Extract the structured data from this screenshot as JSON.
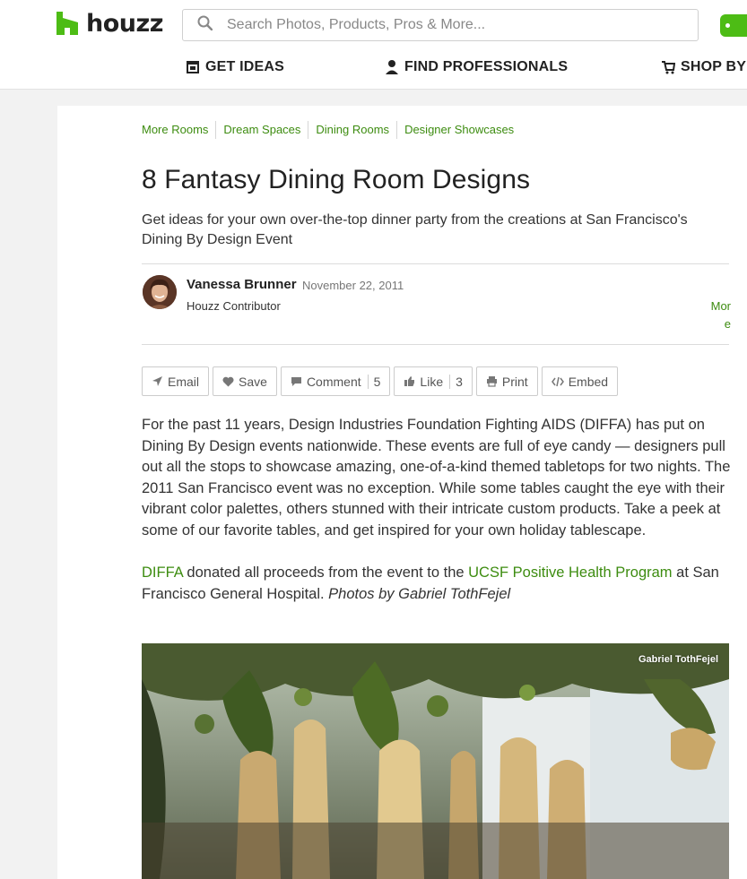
{
  "header": {
    "logo_text": "houzz",
    "search_placeholder": "Search Photos, Products, Pros & More...",
    "brand_color": "#4dbc15"
  },
  "nav": [
    {
      "label": "GET IDEAS",
      "icon": "gallery-icon"
    },
    {
      "label": "FIND PROFESSIONALS",
      "icon": "professional-icon"
    },
    {
      "label": "SHOP BY D",
      "icon": "shopping-cart-icon"
    }
  ],
  "breadcrumbs": [
    "More Rooms",
    "Dream Spaces",
    "Dining Rooms",
    "Designer Showcases"
  ],
  "article": {
    "title": "8 Fantasy Dining Room Designs",
    "subtitle": "Get ideas for your own over-the-top dinner party from the creations at San Francisco's Dining By Design Event",
    "author": {
      "name": "Vanessa Brunner",
      "date": "November 22, 2011",
      "role": "Houzz Contributor",
      "more_label": "More"
    },
    "actions": {
      "email": "Email",
      "save": "Save",
      "comment": "Comment",
      "comment_count": "5",
      "like": "Like",
      "like_count": "3",
      "print": "Print",
      "embed": "Embed"
    },
    "paragraph1": "For the past 11 years, Design Industries Foundation Fighting AIDS (DIFFA) has put on Dining By Design events nationwide. These events are full of eye candy — designers pull out all the stops to showcase amazing, one-of-a-kind themed tabletops for two nights. The 2011 San Francisco event was no exception. While some tables caught the eye with their vibrant color palettes, others stunned with their intricate custom products. Take a peek at some of our favorite tables, and get inspired for your own holiday tablescape.",
    "paragraph2": {
      "link1": "DIFFA",
      "text1": " donated all proceeds from the event to the ",
      "link2": "UCSF Positive Health Program",
      "text2": " at San Francisco General Hospital. ",
      "italic": "Photos by Gabriel TothFejel"
    },
    "photo_credit": "Gabriel TothFejel"
  }
}
